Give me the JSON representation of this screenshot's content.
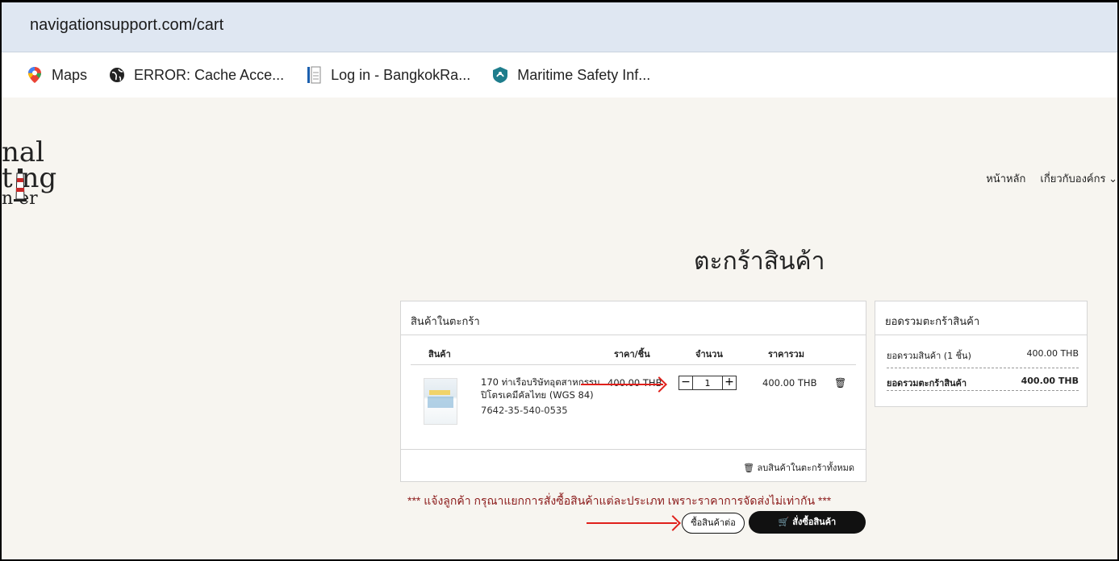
{
  "browser": {
    "url": "navigationsupport.com/cart",
    "bookmarks": [
      {
        "label": "Maps",
        "icon": "maps-pin-icon"
      },
      {
        "label": "ERROR: Cache Acce...",
        "icon": "globe-icon"
      },
      {
        "label": "Log in - BangkokRa...",
        "icon": "document-icon"
      },
      {
        "label": "Maritime Safety Inf...",
        "icon": "maritime-shield-icon"
      }
    ]
  },
  "site": {
    "logo_lines": [
      "nal",
      "t ng",
      "n  er"
    ],
    "nav": {
      "home": "หน้าหลัก",
      "about": "เกี่ยวกับองค์กร"
    }
  },
  "cart": {
    "page_title": "ตะกร้าสินค้า",
    "header": "สินค้าในตะกร้า",
    "columns": {
      "product": "สินค้า",
      "unit_price": "ราคา/ชิ้น",
      "quantity": "จำนวน",
      "total": "ราคารวม"
    },
    "item": {
      "name_line1": "170 ท่าเรือบริษัทอุตสาหกรรม",
      "name_line2": "ปิโตรเคมีคัลไทย (WGS 84)",
      "code": "7642-35-540-0535",
      "unit_price": "400.00 THB",
      "quantity": "1",
      "total": "400.00 THB"
    },
    "clear_all": "ลบสินค้าในตะกร้าทั้งหมด"
  },
  "summary": {
    "header": "ยอดรวมตะกร้าสินค้า",
    "subtotal_label": "ยอดรวมสินค้า (1 ชิ้น)",
    "subtotal_value": "400.00 THB",
    "total_label": "ยอดรวมตะกร้าสินค้า",
    "total_value": "400.00 THB"
  },
  "notice": "*** แจ้งลูกค้า กรุณาแยกการสั่งซื้อสินค้าแต่ละประเภท เพราะราคาการจัดส่งไม่เท่ากัน ***",
  "actions": {
    "continue_shopping": "ซื้อสินค้าต่อ",
    "place_order": "สั่งซื้อสินค้า"
  },
  "colors": {
    "annotation_arrow": "#e0201b",
    "notice_text": "#8b1a1a",
    "order_button": "#111111"
  }
}
